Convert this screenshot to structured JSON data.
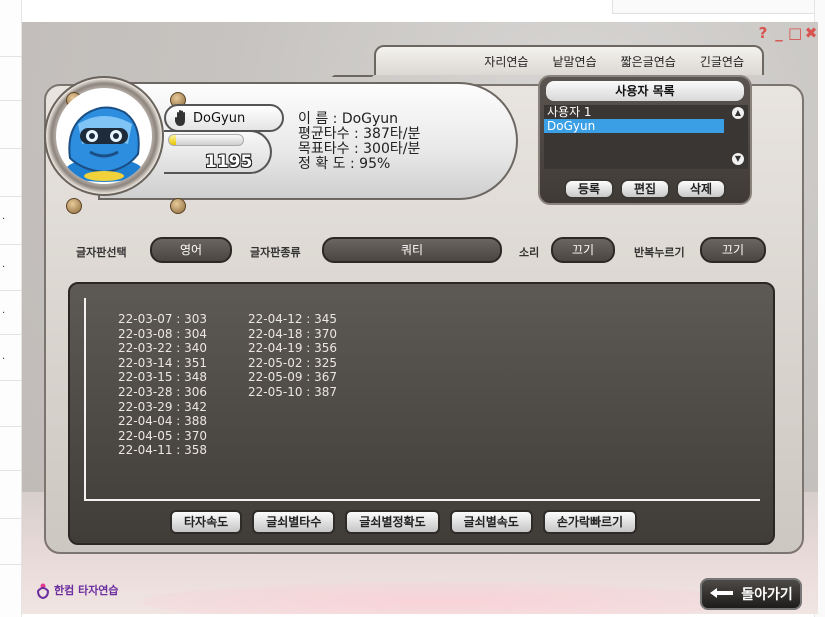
{
  "window_controls": {
    "help": "?",
    "minimize": "_",
    "maximize": "□",
    "close": "✖"
  },
  "tabs": [
    {
      "label": "자리연습"
    },
    {
      "label": "낱말연습"
    },
    {
      "label": "짧은글연습"
    },
    {
      "label": "긴글연습"
    }
  ],
  "profile": {
    "name_pill": "DoGyun",
    "score": "1195",
    "gauge_fraction": 0.1,
    "info_lines": [
      "이    름 : DoGyun",
      "평균타수 : 387타/분",
      "목표타수 : 300타/분",
      "정 확 도 : 95%"
    ]
  },
  "user_panel": {
    "title": "사용자 목록",
    "users": [
      "사용자 1",
      "DoGyun"
    ],
    "selected_index": 1,
    "buttons": {
      "register": "등록",
      "edit": "편집",
      "delete": "삭제"
    }
  },
  "options": {
    "keyboard_select_label": "글자판선택",
    "keyboard_select_value": "영어",
    "keyboard_type_label": "글자판종류",
    "keyboard_type_value": "쿼티",
    "sound_label": "소리",
    "sound_value": "끄기",
    "repeat_label": "반복누르기",
    "repeat_value": "끄기"
  },
  "records": {
    "col1": [
      "22-03-07 : 303",
      "22-03-08 : 304",
      "22-03-22 : 340",
      "22-03-14 : 351",
      "22-03-15 : 348",
      "22-03-28 : 306",
      "22-03-29 : 342",
      "22-04-04 : 388",
      "22-04-05 : 370",
      "22-04-11 : 358"
    ],
    "col2": [
      "22-04-12 : 345",
      "22-04-18 : 370",
      "22-04-19 : 356",
      "22-05-02 : 325",
      "22-05-09 : 367",
      "22-05-10 : 387"
    ],
    "buttons": [
      "타자속도",
      "글쇠별타수",
      "글쇠별정확도",
      "글쇠별속도",
      "손가락빠르기"
    ]
  },
  "footer": {
    "logo_text": "한컴 타자연습",
    "back_label": "돌아가기"
  }
}
